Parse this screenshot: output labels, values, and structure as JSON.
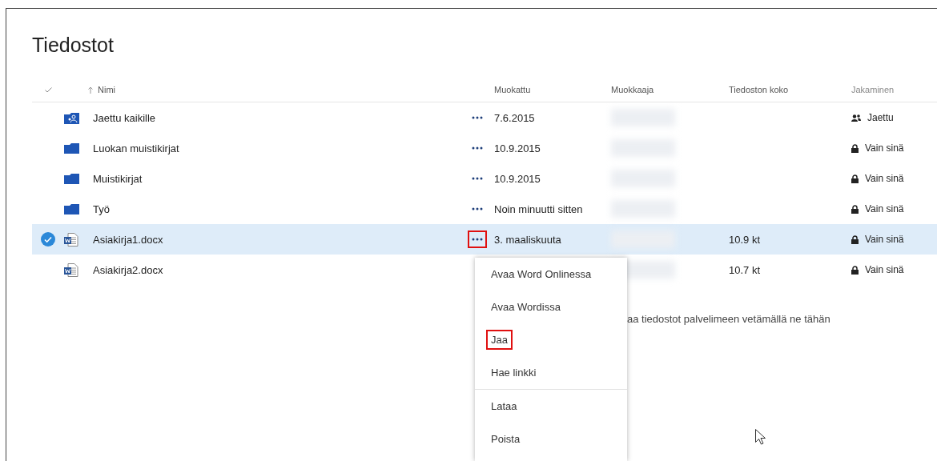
{
  "page": {
    "title": "Tiedostot"
  },
  "table": {
    "columns": [
      "Nimi",
      "Muokattu",
      "Muokkaaja",
      "Tiedoston koko",
      "Jakaminen"
    ],
    "rows": [
      {
        "kind": "shared-folder",
        "name": "Jaettu kaikille",
        "more_button": true,
        "modified": "7.6.2015",
        "modified_by_blurred": true,
        "sharing": {
          "kind": "shared",
          "label": "Jaettu"
        },
        "selected": false,
        "more_highlighted": false
      },
      {
        "kind": "folder",
        "name": "Luokan muistikirjat",
        "more_button": true,
        "modified": "10.9.2015",
        "modified_by_blurred": true,
        "sharing": {
          "kind": "private",
          "label": "Vain sinä"
        },
        "selected": false,
        "more_highlighted": false
      },
      {
        "kind": "folder",
        "name": "Muistikirjat",
        "more_button": true,
        "modified": "10.9.2015",
        "modified_by_blurred": true,
        "sharing": {
          "kind": "private",
          "label": "Vain sinä"
        },
        "selected": false,
        "more_highlighted": false
      },
      {
        "kind": "folder",
        "name": "Työ",
        "more_button": true,
        "modified": "Noin minuutti sitten",
        "modified_by_blurred": true,
        "sharing": {
          "kind": "private",
          "label": "Vain sinä"
        },
        "selected": false,
        "more_highlighted": false
      },
      {
        "kind": "word",
        "name": "Asiakirja1.docx",
        "more_button": true,
        "modified": "3. maaliskuuta",
        "modified_by_blurred": true,
        "size": "10.9 kt",
        "sharing": {
          "kind": "private",
          "label": "Vain sinä"
        },
        "selected": true,
        "more_highlighted": true
      },
      {
        "kind": "word",
        "name": "Asiakirja2.docx",
        "more_button": false,
        "modified_by_blurred": true,
        "size": "10.7 kt",
        "sharing": {
          "kind": "private",
          "label": "Vain sinä"
        },
        "selected": false
      }
    ]
  },
  "drop_hint": "aa tiedostot palvelimeen vetämällä ne tähän",
  "context_menu": {
    "items": [
      {
        "label": "Avaa Word Onlinessa",
        "highlighted": false
      },
      {
        "label": "Avaa Wordissa",
        "highlighted": false
      },
      {
        "label": "Jaa",
        "highlighted": true
      },
      {
        "label": "Hae linkki",
        "highlighted": false,
        "divider_after": true
      },
      {
        "label": "Lataa",
        "highlighted": false
      },
      {
        "label": "Poista",
        "highlighted": false
      }
    ]
  }
}
